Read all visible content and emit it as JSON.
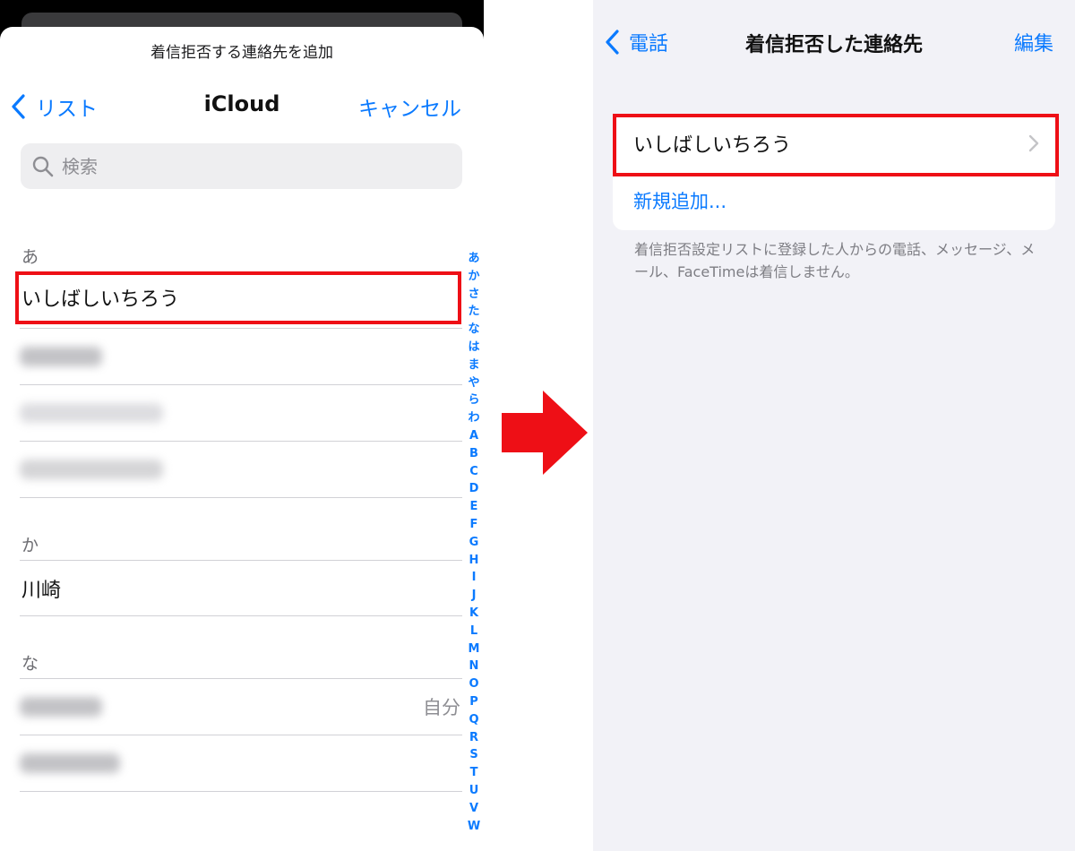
{
  "left": {
    "sheet_title": "着信拒否する連絡先を追加",
    "nav": {
      "back_label": "リスト",
      "title": "iCloud",
      "cancel_label": "キャンセル"
    },
    "search": {
      "placeholder": "検索"
    },
    "sections": [
      {
        "header": "あ",
        "contacts": [
          "いしばしいちろう"
        ]
      },
      {
        "header": "か",
        "contacts": [
          "川崎"
        ]
      },
      {
        "header": "な"
      }
    ],
    "self_badge": "自分",
    "index": [
      "あ",
      "か",
      "さ",
      "た",
      "な",
      "は",
      "ま",
      "や",
      "ら",
      "わ",
      "A",
      "B",
      "C",
      "D",
      "E",
      "F",
      "G",
      "H",
      "I",
      "J",
      "K",
      "L",
      "M",
      "N",
      "O",
      "P",
      "Q",
      "R",
      "S",
      "T",
      "U",
      "V",
      "W"
    ]
  },
  "right": {
    "nav": {
      "back_label": "電話",
      "title": "着信拒否した連絡先",
      "edit_label": "編集"
    },
    "blocked": [
      "いしばしいちろう"
    ],
    "add_new": "新規追加...",
    "footer": "着信拒否設定リストに登録した人からの電話、メッセージ、メール、FaceTimeは着信しません。"
  },
  "colors": {
    "accent": "#0a7aff",
    "highlight": "#ee0f16",
    "arrow": "#ee0f16",
    "grouped_bg": "#f2f2f7"
  },
  "icons": [
    "chevron-left-icon",
    "search-icon",
    "chevron-right-icon",
    "arrow-right-icon"
  ]
}
